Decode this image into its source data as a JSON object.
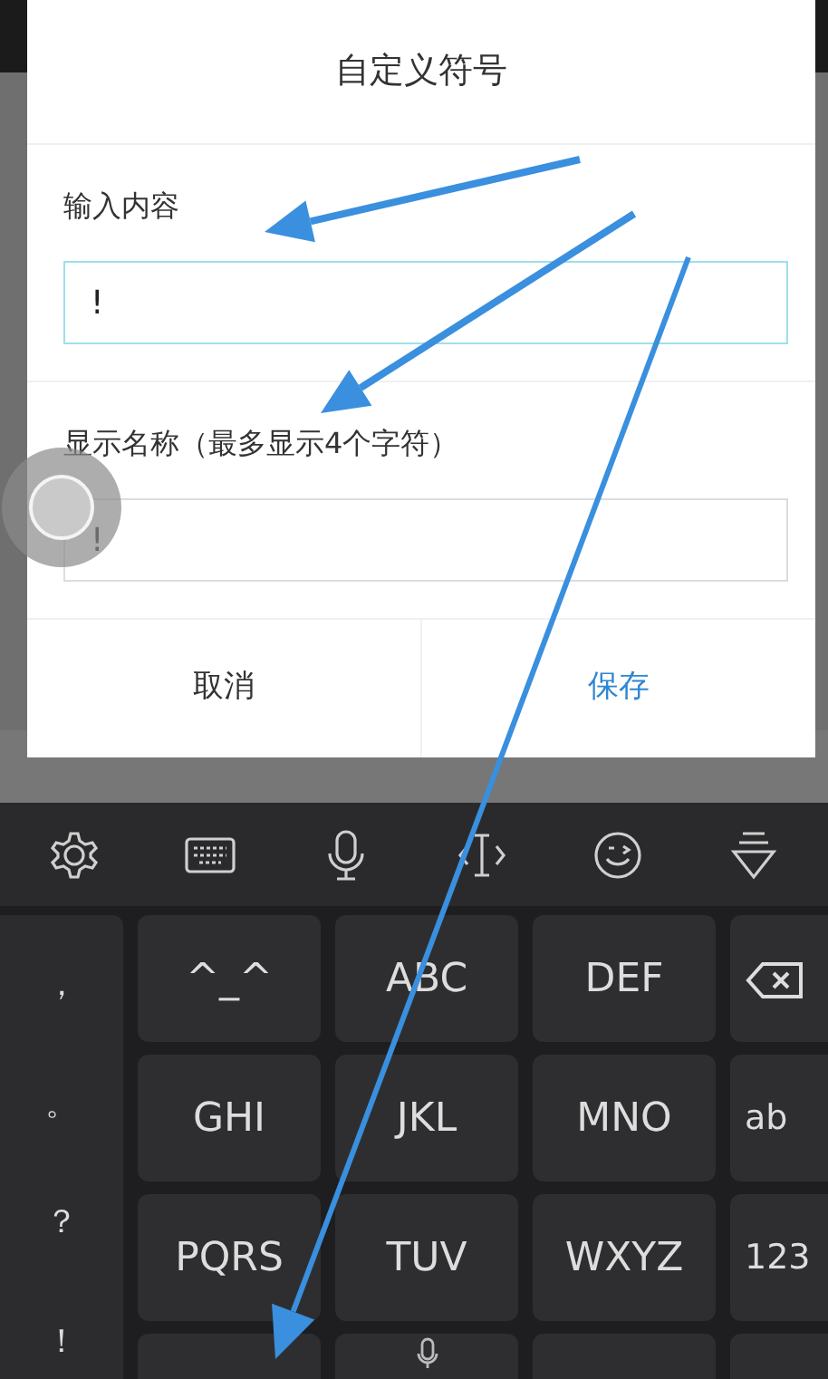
{
  "dialog": {
    "title": "自定义符号",
    "fields": [
      {
        "label": "输入内容",
        "value": "!",
        "focused": true
      },
      {
        "label": "显示名称（最多显示4个字符）",
        "value": "!",
        "focused": false
      }
    ],
    "buttons": [
      {
        "label": "取消",
        "kind": "cancel"
      },
      {
        "label": "保存",
        "kind": "confirm"
      }
    ]
  },
  "keyboard": {
    "toolbar": [
      {
        "kind": "settings"
      },
      {
        "kind": "keyboard"
      },
      {
        "kind": "mic"
      },
      {
        "kind": "cursor"
      },
      {
        "kind": "emoji"
      },
      {
        "kind": "hide"
      }
    ],
    "punctuation": [
      "，",
      "。",
      "？",
      "！"
    ],
    "rows": [
      [
        {
          "kind": "text",
          "label": "^_^"
        },
        {
          "kind": "text",
          "label": "ABC"
        },
        {
          "kind": "text",
          "label": "DEF"
        },
        {
          "kind": "delete"
        }
      ],
      [
        {
          "kind": "text",
          "label": "GHI"
        },
        {
          "kind": "text",
          "label": "JKL"
        },
        {
          "kind": "text",
          "label": "MNO"
        },
        {
          "kind": "text",
          "label": "ab"
        }
      ],
      [
        {
          "kind": "text",
          "label": "PQRS"
        },
        {
          "kind": "text",
          "label": "TUV"
        },
        {
          "kind": "text",
          "label": "WXYZ"
        },
        {
          "kind": "text",
          "label": "123"
        }
      ],
      [
        {
          "kind": "blank"
        },
        {
          "kind": "mic"
        },
        {
          "kind": "blank"
        },
        {
          "kind": "blank"
        }
      ]
    ]
  }
}
